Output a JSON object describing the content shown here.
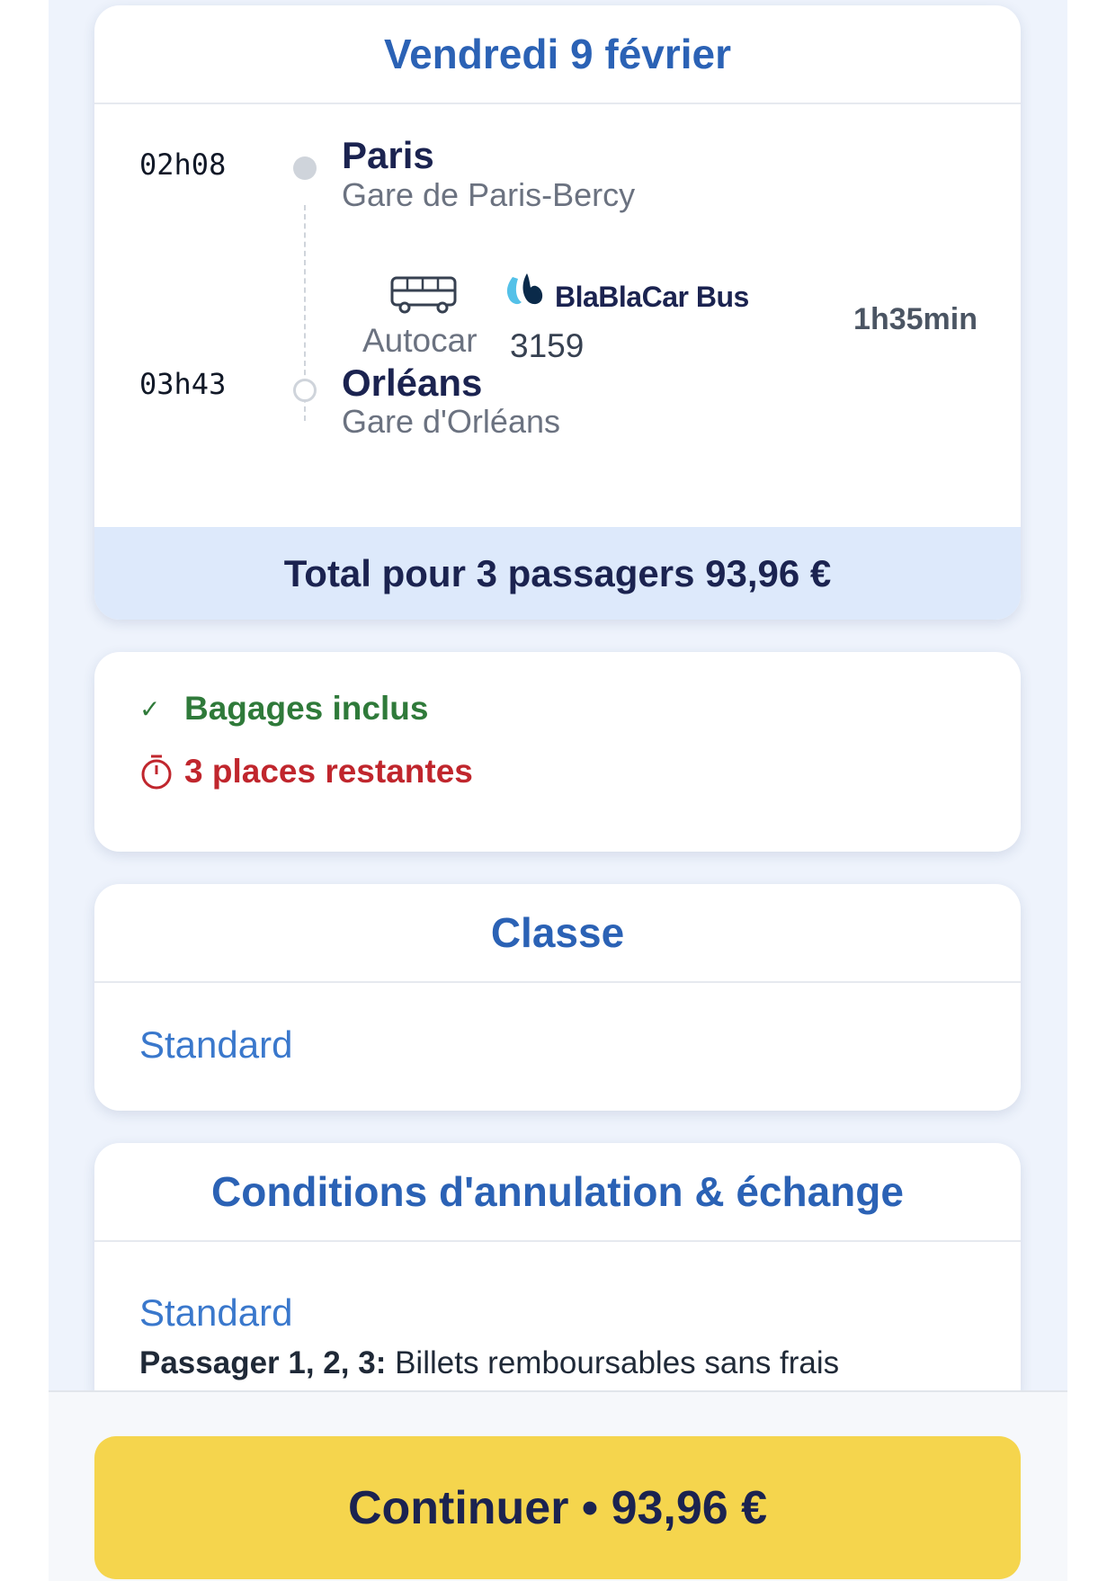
{
  "trip": {
    "date": "Vendredi 9 février",
    "departure": {
      "time": "02h08",
      "city": "Paris",
      "station": "Gare de Paris-Bercy"
    },
    "arrival": {
      "time": "03h43",
      "city": "Orléans",
      "station": "Gare d'Orléans"
    },
    "transport": {
      "mode_icon": "bus-icon",
      "mode_label": "Autocar",
      "brand": "BlaBlaCar Bus",
      "bus_number": "3159",
      "duration": "1h35min"
    },
    "total": "Total pour 3 passagers 93,96 €"
  },
  "info": {
    "check_icon": "checkmark-icon",
    "baggage": "Bagages inclus",
    "timer_icon": "timer-icon",
    "seats": "3 places restantes"
  },
  "class_section": {
    "title": "Classe",
    "value": "Standard"
  },
  "conditions": {
    "title": "Conditions d'annulation & échange",
    "class_name": "Standard",
    "passengers_label": "Passager 1, 2, 3:",
    "rule": "Billets remboursables sans frais"
  },
  "cta": {
    "label": "Continuer • 93,96 €"
  },
  "colors": {
    "accent": "#2b62b5",
    "success": "#2f7a3a",
    "danger": "#c0262d",
    "cta": "#f5d54d",
    "total_bg": "#dde9fb"
  }
}
